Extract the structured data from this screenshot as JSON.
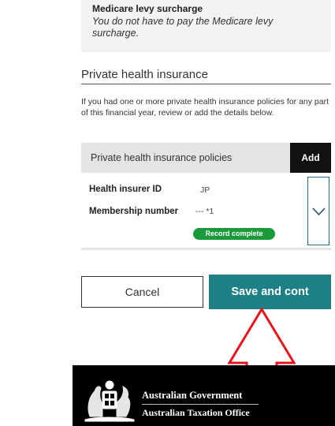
{
  "levy": {
    "title": "Medicare levy surcharge",
    "text": "You do not have to pay the Medicare levy surcharge."
  },
  "section": {
    "title": "Private health insurance",
    "intro": "If you had one or more private health insurance policies for any part of this financial year, review or add the details below."
  },
  "policies": {
    "header": "Private health insurance policies",
    "add_label": "Add",
    "fields": [
      {
        "label": "Health insurer ID",
        "value": "JP"
      },
      {
        "label": "Membership number",
        "value": "--- *1"
      }
    ],
    "status_badge": "Record complete"
  },
  "actions": {
    "cancel_label": "Cancel",
    "save_label": "Save and cont"
  },
  "footer": {
    "line1": "Australian Government",
    "line2": "Australian Taxation Office"
  },
  "colors": {
    "primary": "#1f7f87",
    "success": "#1a9a3a",
    "annotation_arrow": "#e8141a"
  },
  "icons": {
    "expand": "chevron-down-icon",
    "crest": "coat-of-arms-icon",
    "annotation": "up-arrow-icon"
  }
}
